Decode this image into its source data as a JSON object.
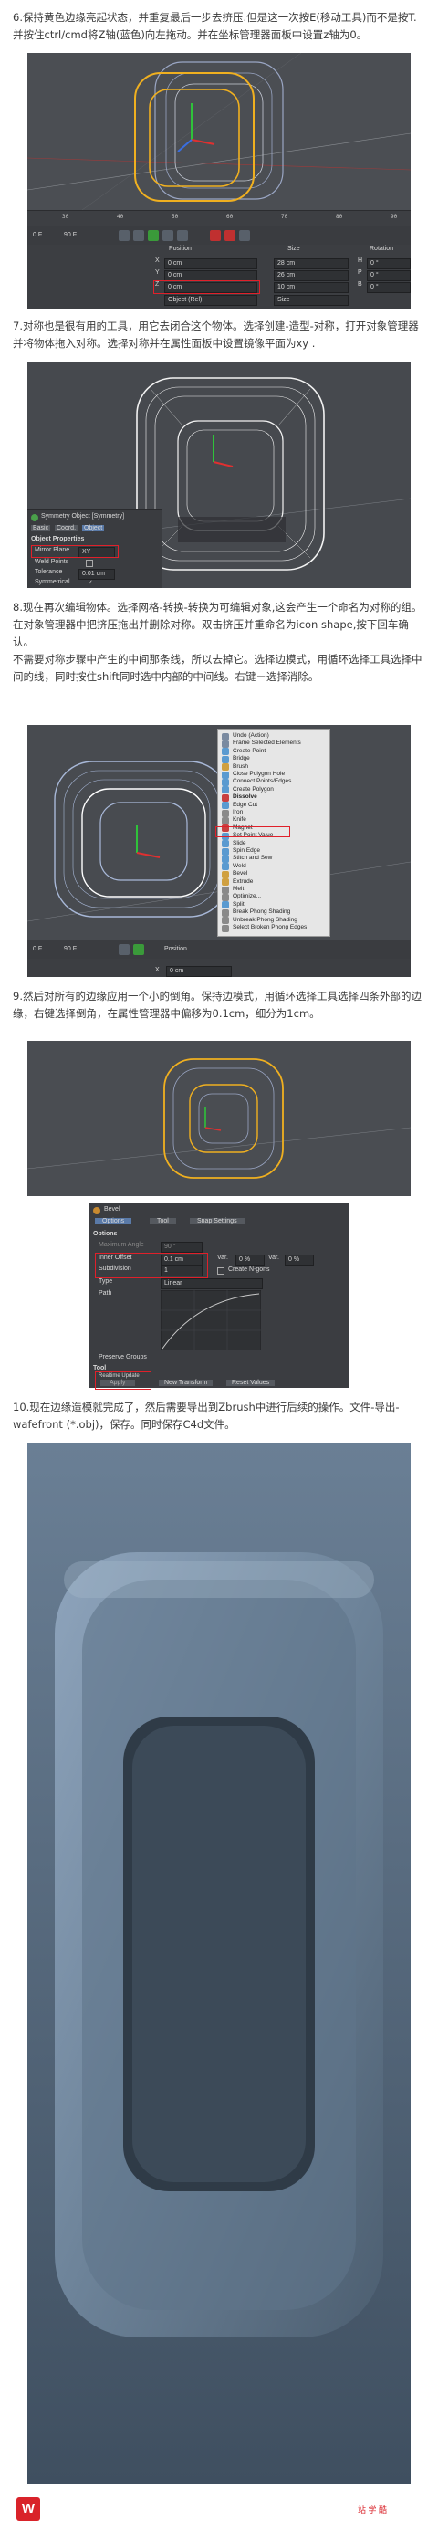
{
  "step6": {
    "text": "6.保持黄色边缘亮起状态，并重复最后一步去挤压.但是这一次按E(移动工具)而不是按T.并按住ctrl/cmd将Z轴(蓝色)向左拖动。并在坐标管理器面板中设置z轴为0。",
    "timeline_ticks": [
      "30",
      "40",
      "50",
      "60",
      "70",
      "80",
      "90"
    ],
    "frame_label": "0 F",
    "frame_end": "90 F",
    "headers": {
      "position": "Position",
      "size": "Size",
      "rotation": "Rotation"
    },
    "rows": [
      {
        "axis": "X",
        "pos": "0 cm",
        "size": "28 cm",
        "rot_label": "H",
        "rot": "0 °"
      },
      {
        "axis": "Y",
        "pos": "0 cm",
        "size": "26 cm",
        "rot_label": "P",
        "rot": "0 °"
      },
      {
        "axis": "Z",
        "pos": "0 cm",
        "size": "10 cm",
        "rot_label": "B",
        "rot": "0 °"
      }
    ],
    "mode_select": "Object (Rel)",
    "mode_select2": "Size"
  },
  "step7": {
    "text": "7.对称也是很有用的工具，用它去闭合这个物体。选择创建-造型-对称，打开对象管理器并将物体拖入对称。选择对称并在属性面板中设置镜像平面为xy .",
    "panel_title": "Symmetry Object [Symmetry]",
    "tabs": [
      "Basic",
      "Coord.",
      "Object"
    ],
    "section": "Object Properties",
    "mirror_plane_label": "Mirror Plane",
    "mirror_plane_value": "XY",
    "weld_points": "Weld Points",
    "tolerance_label": "Tolerance",
    "tolerance_value": "0.01 cm",
    "symmetrical": "Symmetrical"
  },
  "step8": {
    "text": "8.现在再次编辑物体。选择网格-转换-转换为可编辑对象,这会产生一个命名为对称的组。在对象管理器中把挤压拖出并删除对称。双击挤压并重命名为icon shape,按下回车确认。\n不需要对称步骤中产生的中间那条线，所以去掉它。选择边模式，用循环选择工具选择中间的线，同时按住shift同时选中内部的中间线。右键－选择消除。",
    "menu_items": [
      "Undo (Action)",
      "Frame Selected Elements",
      "Create Point",
      "Bridge",
      "Brush",
      "Close Polygon Hole",
      "Connect Points/Edges",
      "Create Polygon",
      "Dissolve",
      "Edge Cut",
      "Iron",
      "Knife",
      "Magnet",
      "Set Point Value",
      "Slide",
      "Spin Edge",
      "Stitch and Sew",
      "Weld",
      "Bevel",
      "Extrude",
      "Melt",
      "Optimize...",
      "Split",
      "Break Phong Shading",
      "Unbreak Phong Shading",
      "Select Broken Phong Edges"
    ],
    "highlighted": "Dissolve",
    "frame_label": "0 F",
    "frame_end": "90 F",
    "position_label": "Position",
    "x_label": "X",
    "x_value": "0 cm"
  },
  "step9": {
    "text": "9.然后对所有的边缘应用一个小的倒角。保持边模式，用循环选择工具选择四条外部的边缘，右键选择倒角，在属性管理器中偏移为0.1cm，细分为1cm。",
    "panel_title": "Bevel",
    "tabs": [
      "Options",
      "Tool",
      "Snap Settings"
    ],
    "section": "Options",
    "maximum_angle": "Maximum Angle",
    "maximum_angle_value": "90 °",
    "inner_offset_label": "Inner Offset",
    "inner_offset_value": "0.1 cm",
    "subdivision_label": "Subdivision",
    "subdivision_value": "1",
    "var_label": "Var.",
    "var_value1": "0 %",
    "var_value2": "0 %",
    "create_ngons": "Create N-gons",
    "type_label": "Type",
    "type_value": "Linear",
    "path_label": "Path",
    "preserve_groups": "Preserve Groups",
    "tool_section": "Tool",
    "realtime_update": "Realtime Update",
    "apply_label": "Apply",
    "new_transform": "New Transform",
    "reset_values": "Reset Values"
  },
  "step10": {
    "text": "10.现在边缘造模就完成了，然后需要导出到Zbrush中进行后续的操作。文件-导出-wafefront (*.obj)，保存。同时保存C4d文件。"
  },
  "footer": {
    "logo": "W",
    "brand": "站 学 酷"
  },
  "colors": {
    "highlight": "#e0202a",
    "accent": "#d9232a",
    "viewport": "#4a4d52"
  }
}
